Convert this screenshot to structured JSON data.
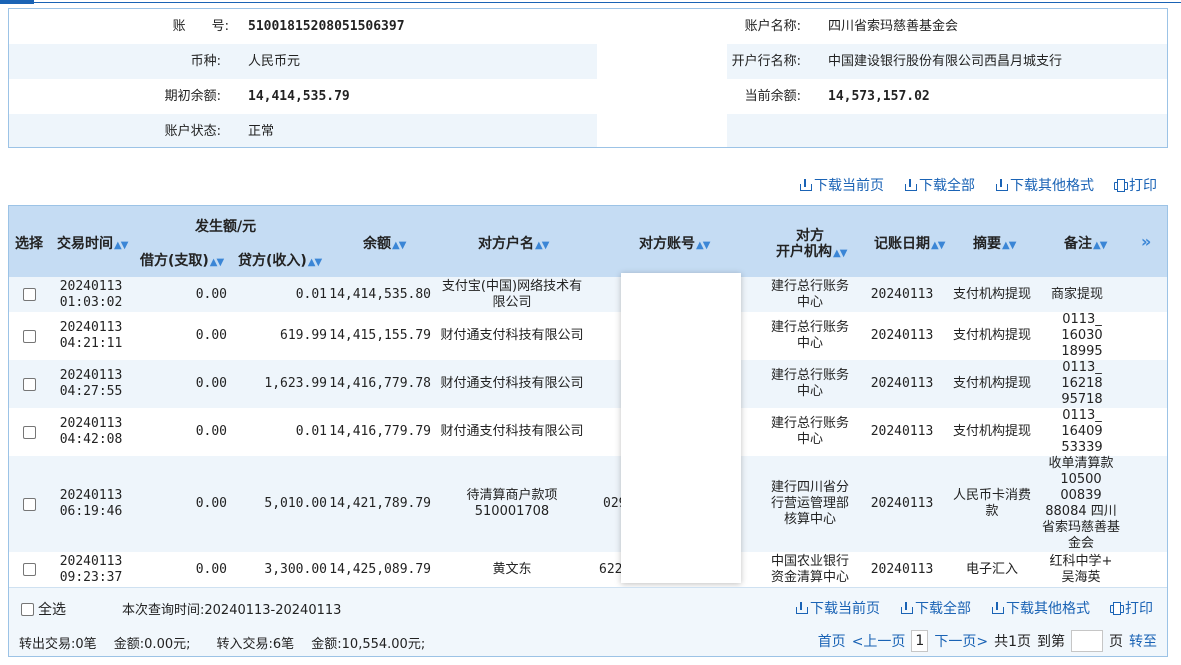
{
  "account_info": {
    "rows": [
      {
        "l1": "账　　号:",
        "v1": "51001815208051506397",
        "l2": "账户名称:",
        "v2": "四川省索玛慈善基金会"
      },
      {
        "l1": "币种:",
        "v1": "人民币元",
        "l2": "开户行名称:",
        "v2": "中国建设银行股份有限公司西昌月城支行"
      },
      {
        "l1": "期初余额:",
        "v1": "14,414,535.79",
        "l2": "当前余额:",
        "v2": "14,573,157.02"
      },
      {
        "l1": "账户状态:",
        "v1": "正常",
        "l2": "",
        "v2": ""
      }
    ]
  },
  "toolbar": {
    "download_current": "下载当前页",
    "download_all": "下载全部",
    "download_other": "下载其他格式",
    "print": "打印"
  },
  "table": {
    "headers": {
      "select": "选择",
      "time": "交易时间",
      "amount_group": "发生额/元",
      "debit": "借方(支取)",
      "credit": "贷方(收入)",
      "balance": "余额",
      "counterparty_name": "对方户名",
      "counterparty_account": "对方账号",
      "counterparty_bank_1": "对方",
      "counterparty_bank_2": "开户机构",
      "post_date": "记账日期",
      "summary": "摘要",
      "remark": "备注",
      "more": "»"
    },
    "rows": [
      {
        "date": "20240113",
        "time": "01:03:02",
        "debit": "0.00",
        "credit": "0.01",
        "balance": "14,414,535.80",
        "name": "支付宝(中国)网络技术有限公司",
        "account": "",
        "bank": "建行总行账务中心",
        "post_date": "20240113",
        "summary": "支付机构提现",
        "remark": "商家提现"
      },
      {
        "date": "20240113",
        "time": "04:21:11",
        "debit": "0.00",
        "credit": "619.99",
        "balance": "14,415,155.79",
        "name": "财付通支付科技有限公司",
        "account": "",
        "bank": "建行总行账务中心",
        "post_date": "20240113",
        "summary": "支付机构提现",
        "remark": "0113_ 16030 18995"
      },
      {
        "date": "20240113",
        "time": "04:27:55",
        "debit": "0.00",
        "credit": "1,623.99",
        "balance": "14,416,779.78",
        "name": "财付通支付科技有限公司",
        "account": "",
        "bank": "建行总行账务中心",
        "post_date": "20240113",
        "summary": "支付机构提现",
        "remark": "0113_ 16218 95718"
      },
      {
        "date": "20240113",
        "time": "04:42:08",
        "debit": "0.00",
        "credit": "0.01",
        "balance": "14,416,779.79",
        "name": "财付通支付科技有限公司",
        "account": "",
        "bank": "建行总行账务中心",
        "post_date": "20240113",
        "summary": "支付机构提现",
        "remark": "0113_ 16409 53339"
      },
      {
        "date": "20240113",
        "time": "06:19:46",
        "debit": "0.00",
        "credit": "5,010.00",
        "balance": "14,421,789.79",
        "name": "待清算商户款项510001708",
        "account": "029",
        "bank": "建行四川省分行营运管理部核算中心",
        "post_date": "20240113",
        "summary": "人民币卡消费款",
        "remark": "收单清算款 10500 00839 88084 四川省索玛慈善基金会"
      },
      {
        "date": "20240113",
        "time": "09:23:37",
        "debit": "0.00",
        "credit": "3,300.00",
        "balance": "14,425,089.79",
        "name": "黄文东",
        "account": "622",
        "bank": "中国农业银行资金清算中心",
        "post_date": "20240113",
        "summary": "电子汇入",
        "remark": "红科中学+ 吴海英"
      }
    ]
  },
  "footer": {
    "select_all": "全选",
    "query_time": "本次查询时间:20240113-20240113",
    "stats": "转出交易:0笔　 金额:0.00元;　　转入交易:6笔　 金额:10,554.00元;",
    "first": "首页",
    "prev": "<上一页",
    "current_page": "1",
    "next": "下一页>",
    "total": "共1页",
    "goto": "到第",
    "page_unit": "页",
    "go": "转至"
  }
}
